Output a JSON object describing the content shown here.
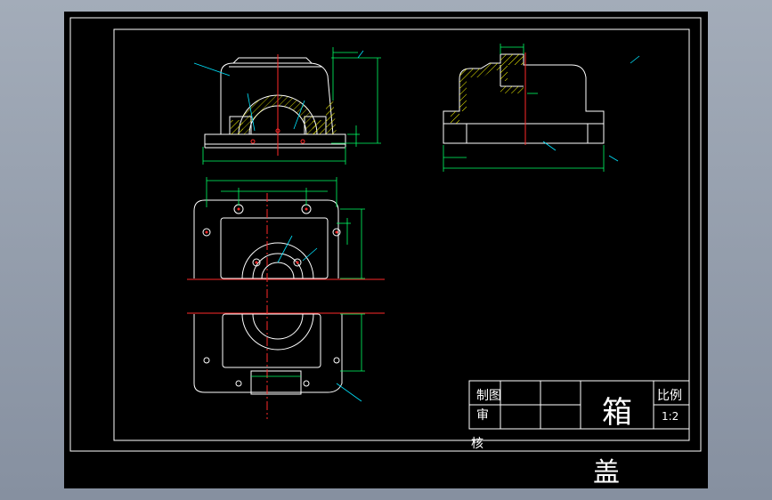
{
  "title_block": {
    "drawn_label": "制图",
    "checked_label": "审",
    "approved_label": "核",
    "part_name_line1": "箱",
    "part_name_line2": "盖",
    "scale_label": "比例",
    "scale_value": "1:2"
  },
  "colors": {
    "background": "#000000",
    "outline": "#ffffff",
    "dimension": "#00ff66",
    "centerline": "#ff2a2a",
    "hatch": "#ffff00",
    "leader": "#00e5ff"
  }
}
